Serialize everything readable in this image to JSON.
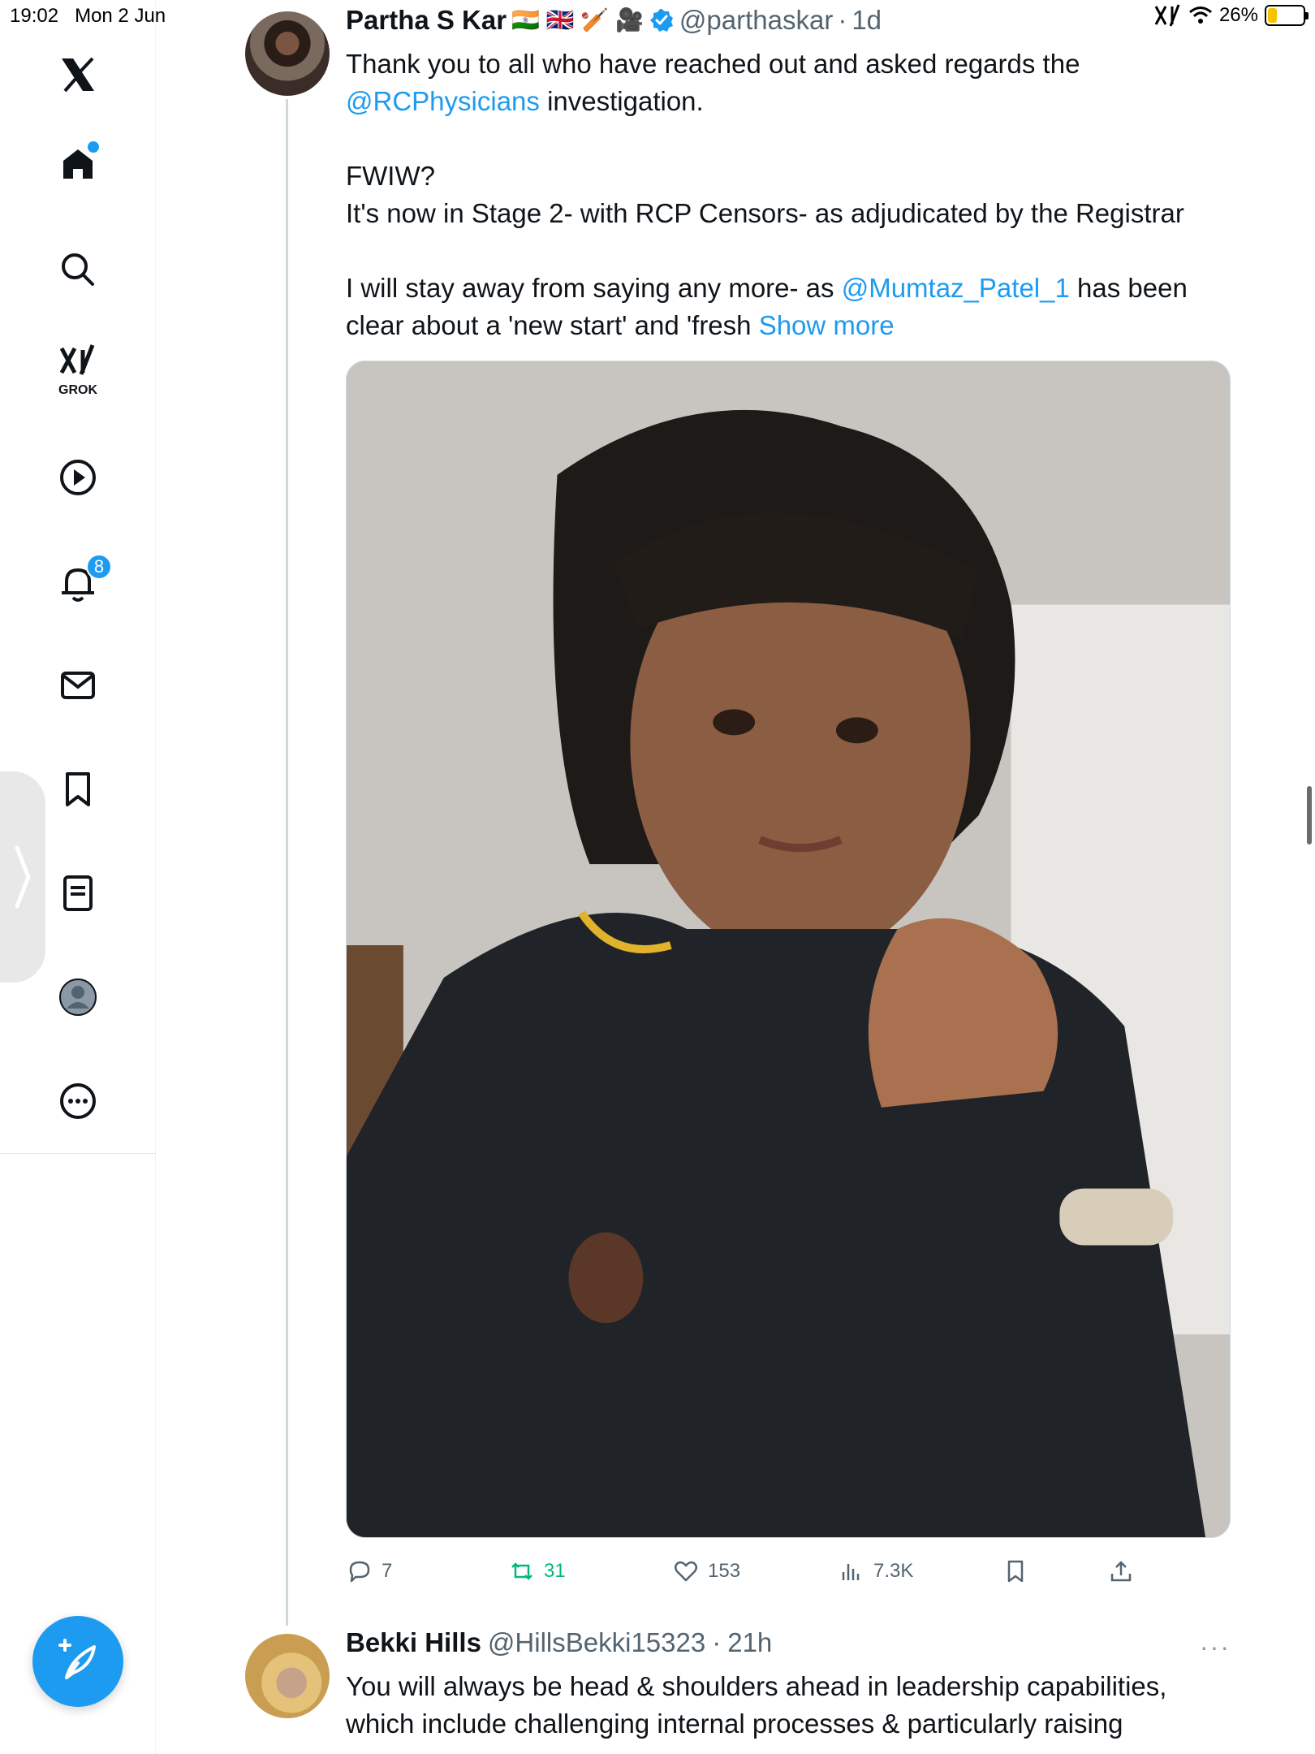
{
  "status_bar": {
    "time": "19:02",
    "date": "Mon 2 Jun",
    "battery": "26%",
    "battery_level": 0.26
  },
  "sidebar": {
    "notifications_badge": "8",
    "grok_label": "GROK",
    "icons": [
      "x-logo-icon",
      "home-icon",
      "search-icon",
      "grok-icon",
      "video-play-icon",
      "bell-icon",
      "mail-icon",
      "bookmark-icon",
      "lists-icon",
      "profile-icon",
      "more-icon",
      "compose-icon"
    ]
  },
  "tweet": {
    "name": "Partha S Kar",
    "emojis": "🇮🇳 🇬🇧 🏏 🎥",
    "handle": "@parthaskar",
    "separator": "·",
    "time": "1d",
    "line1": "Thank you to all who have reached out and asked regards the",
    "line2_link": "@RCPhysicians",
    "line2_text": " investigation.",
    "line3": "FWIW?",
    "line4": "It's now in Stage 2- with RCP Censors- as adjudicated by the Registrar",
    "line5_text": "I will stay away from saying any more- as ",
    "line5_link": "@Mumtaz_Patel_1",
    "line5_tail": " has been",
    "line6_text": "clear about a 'new start' and 'fresh ",
    "show_more": "Show more",
    "actions": {
      "replies": "7",
      "reposts": "31",
      "likes": "153",
      "views": "7.3K"
    }
  },
  "reply": {
    "name": "Bekki Hills",
    "handle": "@HillsBekki15323",
    "separator": "·",
    "time": "21h",
    "more": "···",
    "line1": "You will always be head & shoulders ahead in leadership capabilities,",
    "line2": "which include challenging internal processes & particularly raising"
  },
  "colors": {
    "accent": "#1d9bf0",
    "repost_active": "#00ba7c",
    "secondary_text": "#536471"
  }
}
